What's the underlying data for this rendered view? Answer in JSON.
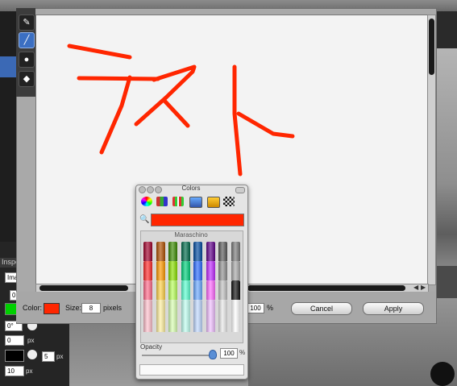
{
  "sheet": {
    "tools": [
      {
        "name": "pencil-icon",
        "glyph": "✎"
      },
      {
        "name": "brush-icon",
        "glyph": "🖌"
      },
      {
        "name": "dropper-icon",
        "glyph": "💧"
      },
      {
        "name": "bucket-icon",
        "glyph": "🪣"
      }
    ],
    "color_label": "Color:",
    "size_label": "Size:",
    "size_value": "8",
    "size_unit": "pixels",
    "opacity_value": "100",
    "opacity_unit": "%",
    "cancel_label": "Cancel",
    "apply_label": "Apply",
    "brush_color": "#ff2600"
  },
  "colors_panel": {
    "title": "Colors",
    "palette_name": "Maraschino",
    "selected_color": "#ff2600",
    "opacity_label": "Opacity",
    "opacity_value": "100",
    "opacity_unit": "%"
  },
  "inspector": {
    "title": "Inspe",
    "image_field": "Ima",
    "zero_field": "0",
    "angle_field": "0°",
    "pos_field": "0",
    "pos_unit": "px",
    "stroke_field": "5",
    "stroke_unit": "px",
    "size_field": "10",
    "size_unit": "px"
  }
}
